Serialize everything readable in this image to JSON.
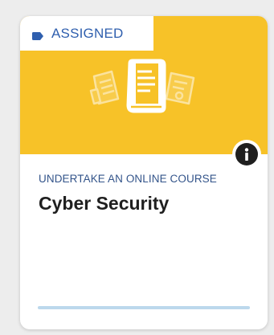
{
  "colors": {
    "banner": "#f7c228",
    "badge_accent": "#2f5fae",
    "subtitle": "#33548a",
    "title": "#1f1f1f",
    "info_button": "#1f1f1f",
    "progress_track": "#bcd8ec",
    "progress_fill": "#7fb3d9"
  },
  "card": {
    "status_badge": {
      "label": "ASSIGNED",
      "icon": "label-tag-icon"
    },
    "hero_icons": [
      "document-icon",
      "book-icon",
      "certificate-icon"
    ],
    "info_icon": "info-icon",
    "subtitle": "UNDERTAKE AN ONLINE COURSE",
    "title": "Cyber Security",
    "progress": 0
  }
}
